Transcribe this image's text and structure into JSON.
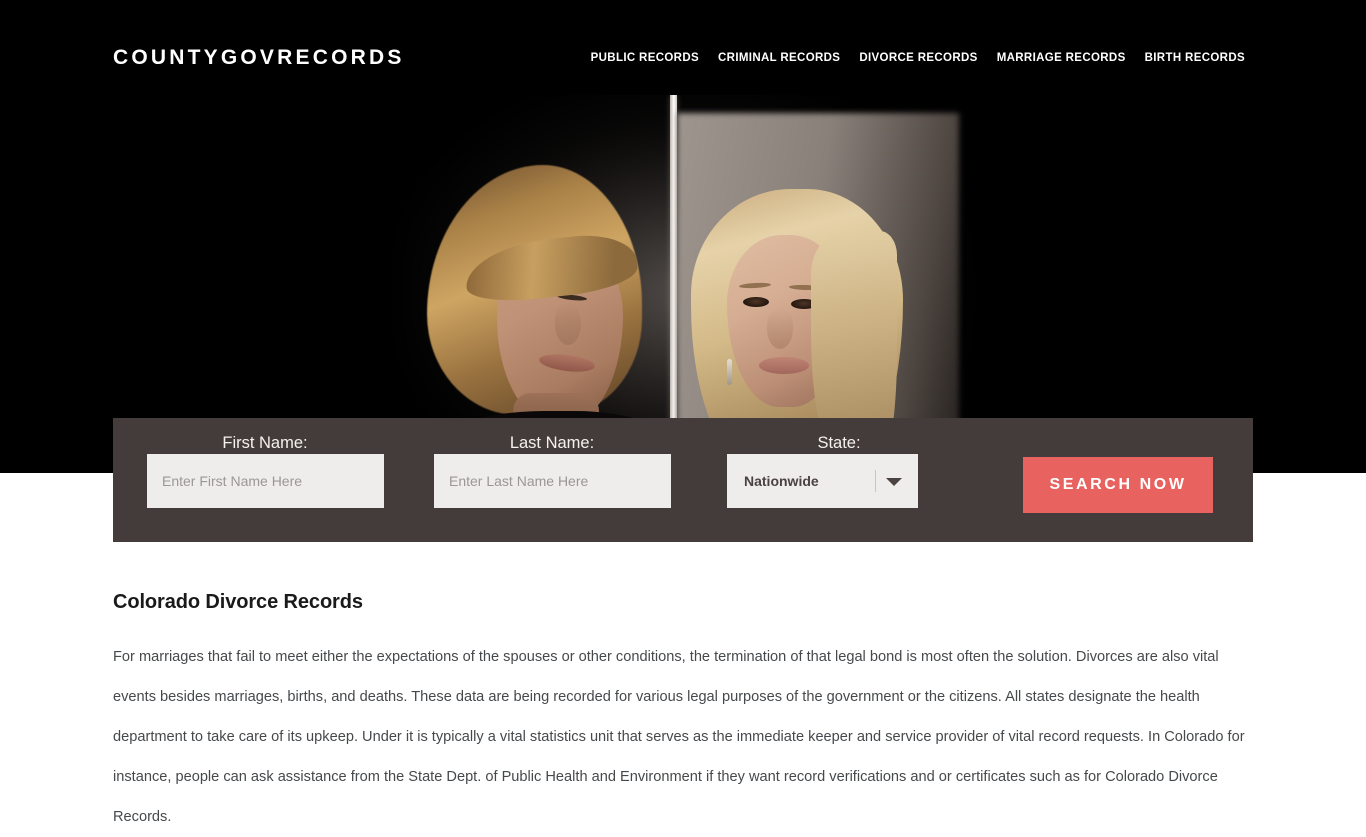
{
  "header": {
    "logo": "COUNTYGOVRECORDS",
    "nav": [
      {
        "label": "PUBLIC RECORDS"
      },
      {
        "label": "CRIMINAL RECORDS"
      },
      {
        "label": "DIVORCE RECORDS"
      },
      {
        "label": "MARRIAGE RECORDS"
      },
      {
        "label": "BIRTH RECORDS"
      }
    ]
  },
  "hero": {
    "alt": "A man and a woman standing back to back separated by a white divider"
  },
  "search": {
    "first_name_label": "First Name:",
    "first_name_placeholder": "Enter First Name Here",
    "first_name_value": "",
    "last_name_label": "Last Name:",
    "last_name_placeholder": "Enter Last Name Here",
    "last_name_value": "",
    "state_label": "State:",
    "state_value": "Nationwide",
    "submit_label": "SEARCH NOW"
  },
  "main": {
    "heading": "Colorado Divorce Records",
    "paragraph": "For marriages that fail to meet either the expectations of the spouses or other conditions, the termination of that legal bond is most often the solution. Divorces are also vital events besides marriages, births, and deaths. These data are being recorded for various legal purposes of the government or the citizens. All states designate the health department to take care of its upkeep. Under it is typically a vital statistics unit that serves as the immediate keeper and service provider of vital record requests. In Colorado for instance, people can ask assistance from the State Dept. of Public Health and Environment if they want record verifications and or certificates such as for Colorado Divorce Records."
  },
  "colors": {
    "header_bg": "#000000",
    "search_bar_bg": "#443c3a",
    "button_bg": "#e8625f",
    "input_bg": "#eeedec",
    "page_bg": "#ffffff",
    "body_text": "#46494c"
  }
}
